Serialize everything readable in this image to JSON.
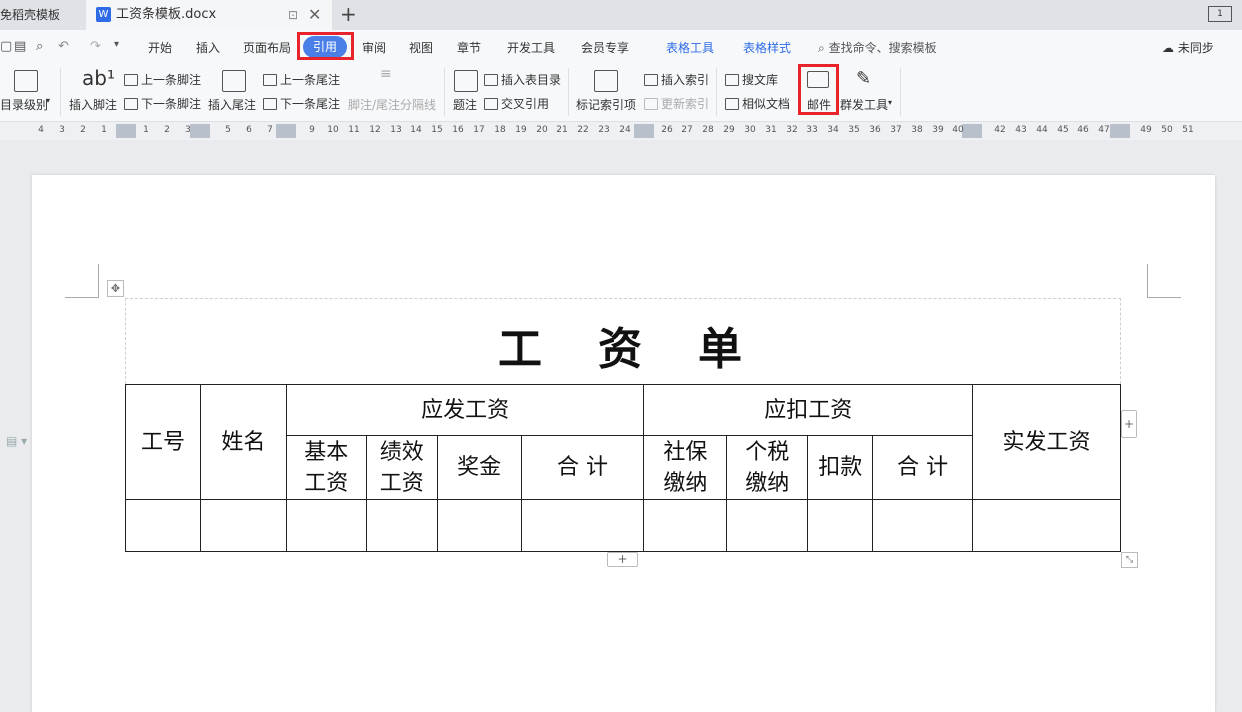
{
  "titlebar": {
    "prev_tab": "免稻壳模板",
    "doc_tab": "工资条模板.docx",
    "doc_icon": "W",
    "pin_glyph": "⊡",
    "close_glyph": "✕",
    "new_tab_glyph": "+",
    "window_badge": "1"
  },
  "menu": {
    "items": [
      "开始",
      "插入",
      "页面布局",
      "引用",
      "审阅",
      "视图",
      "章节",
      "开发工具",
      "会员专享"
    ],
    "active": "引用",
    "tool_tabs": [
      "表格工具",
      "表格样式"
    ],
    "search": "查找命令、搜索模板",
    "sync": "未同步"
  },
  "ribbon": {
    "toc_level": "目录级别",
    "insert_footnote": "插入脚注",
    "prev_footnote": "上一条脚注",
    "next_footnote": "下一条脚注",
    "insert_endnote": "插入尾注",
    "prev_endnote": "上一条尾注",
    "next_endnote": "下一条尾注",
    "footnote_separator": "脚注/尾注分隔线",
    "caption": "题注",
    "insert_table_of_figures": "插入表目录",
    "cross_reference": "交叉引用",
    "mark_index": "标记索引项",
    "insert_index": "插入索引",
    "update_index": "更新索引",
    "search_library": "搜文库",
    "similar_docs": "相似文档",
    "mail": "邮件",
    "mass_tools": "群发工具"
  },
  "ruler": {
    "left_numbers": [
      "4",
      "3",
      "2",
      "1",
      "1",
      "2",
      "3"
    ],
    "numbers": [
      "5",
      "6",
      "7",
      "9",
      "10",
      "11",
      "12",
      "13",
      "14",
      "15",
      "16",
      "17",
      "18",
      "19",
      "20",
      "21",
      "22",
      "23",
      "24",
      "26",
      "27",
      "28",
      "29",
      "30",
      "31",
      "32",
      "33",
      "34",
      "35",
      "36",
      "37",
      "38",
      "39",
      "40",
      "42",
      "43",
      "44",
      "45",
      "46",
      "47",
      "49",
      "50",
      "51"
    ]
  },
  "document": {
    "title": "工　资　单",
    "header_row1": {
      "id": "工号",
      "name": "姓名",
      "gross": "应发工资",
      "deduct": "应扣工资",
      "net": "实发工资"
    },
    "header_row2": {
      "base_a": "基本",
      "base_b": "工资",
      "perf_a": "绩效",
      "perf_b": "工资",
      "bonus": "奖金",
      "total1": "合 计",
      "ss_a": "社保",
      "ss_b": "缴纳",
      "tax_a": "个税",
      "tax_b": "缴纳",
      "deduction": "扣款",
      "total2": "合 计"
    }
  },
  "colors": {
    "accent": "#4a7fe8",
    "highlight": "#e8232a",
    "tool_tab": "#2e6be6"
  }
}
